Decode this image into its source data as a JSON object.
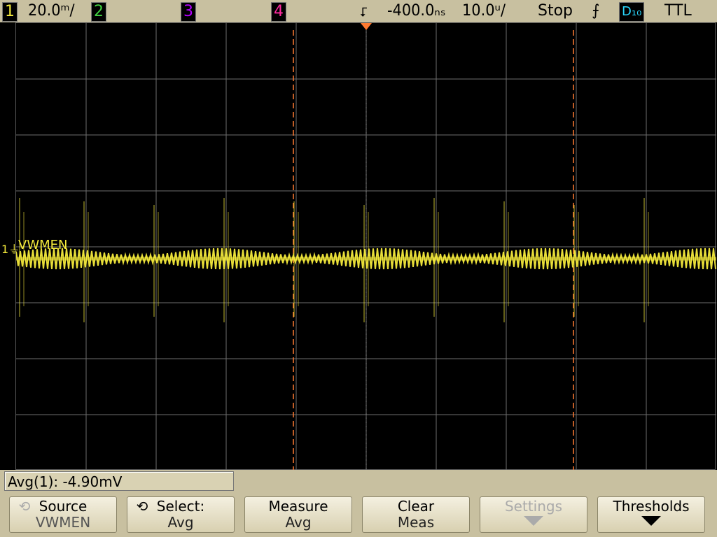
{
  "status": {
    "ch1_num": "1",
    "ch1_scale": "20.0ᵐ/",
    "ch2_num": "2",
    "ch3_num": "3",
    "ch4_num": "4",
    "trigger_delay": "-400.0ₙₛ",
    "time_scale": "10.0ᵘ/",
    "run_state": "Stop",
    "trigger_edge": "⨍",
    "digital_label": "D₁₀",
    "trigger_level": "TTL"
  },
  "channel_label": "VWMEN",
  "channel_marker": "1",
  "measurement": "Avg(1): -4.90mV",
  "softkeys": [
    {
      "line1": "Source",
      "line2": "VWMEN"
    },
    {
      "line1": "Select:",
      "line2": "Avg"
    },
    {
      "line1": "Measure",
      "line2": "Avg"
    },
    {
      "line1": "Clear",
      "line2": "Meas"
    },
    {
      "line1": "Settings",
      "line2": ""
    },
    {
      "line1": "Thresholds",
      "line2": ""
    }
  ],
  "colors": {
    "ch1": "#f5eb3c",
    "ch2": "#41d241",
    "ch3": "#b400ff",
    "ch4": "#ff2aa0",
    "digital": "#2ad8ff",
    "cursor": "#ff7a30",
    "grid": "#6e6e6e"
  },
  "icons": {
    "trigger_position": "down-arrow-trigger-icon",
    "knob": "rotary-knob-icon",
    "more": "down-arrow-icon"
  }
}
